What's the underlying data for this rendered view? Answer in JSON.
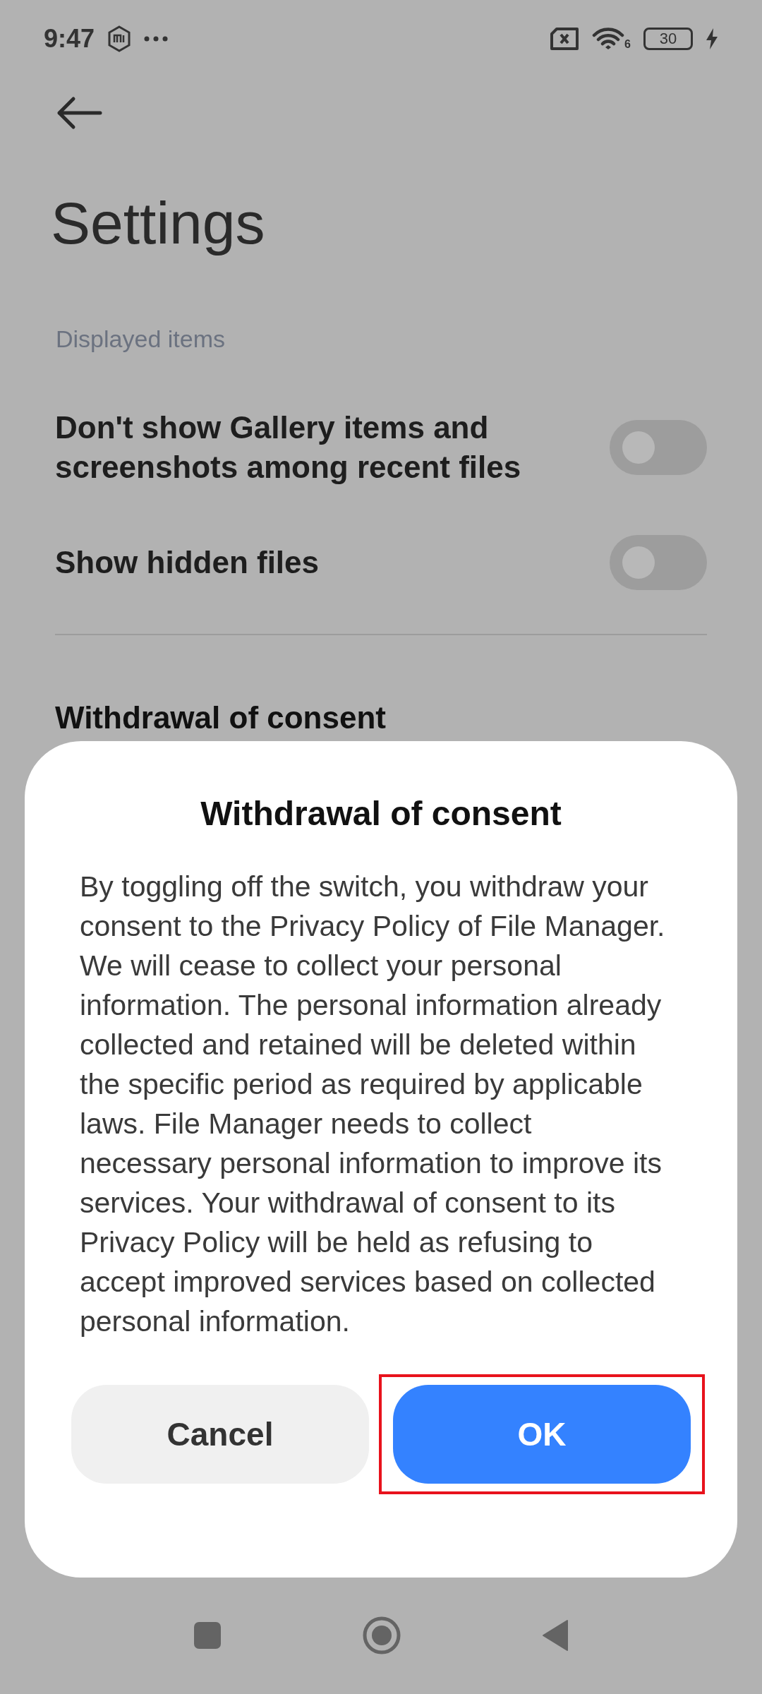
{
  "status_bar": {
    "time": "9:47",
    "battery": "30",
    "wifi_badge": "6"
  },
  "header": {
    "title": "Settings"
  },
  "section": {
    "title": "Displayed items"
  },
  "settings": [
    {
      "label": "Don't show Gallery items and screenshots among recent files",
      "on": false
    },
    {
      "label": "Show hidden files",
      "on": false
    }
  ],
  "behind_item": {
    "label": "Withdrawal of consent"
  },
  "dialog": {
    "title": "Withdrawal of consent",
    "message": "By toggling off the switch, you withdraw your consent to the Privacy Policy of File Manager. We will cease to collect your personal information. The personal information already collected and retained will be deleted within the specific period as required by applicable laws. File Manager needs to collect necessary personal information to improve its services. Your withdrawal of consent to its Privacy Policy will be held as refusing to accept improved services based on collected personal information.",
    "buttons": [
      {
        "label": "Cancel",
        "kind": "secondary",
        "highlighted": false
      },
      {
        "label": "OK",
        "kind": "primary",
        "highlighted": true
      }
    ]
  }
}
